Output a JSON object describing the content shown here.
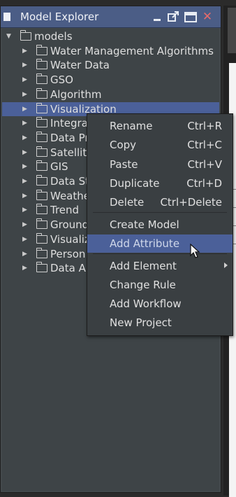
{
  "panel": {
    "title": "Model Explorer",
    "close_glyph": "✕",
    "icons": [
      "window-icon",
      "minimize-icon",
      "restore-icon",
      "maximize-icon",
      "close-icon"
    ]
  },
  "tree": {
    "root": {
      "label": "models",
      "expanded": true
    },
    "children": [
      "Water Management Algorithms",
      "Water Data",
      "GSO",
      "Algorithm",
      "Visualization",
      "Integrat",
      "Data Pr",
      "Satellite",
      "GIS",
      "Data St",
      "Weathe",
      "Trend",
      "Ground",
      "Visualiz",
      "Person",
      "Data Ar"
    ],
    "selected_index": 4
  },
  "context_menu": {
    "items": [
      {
        "label": "Rename",
        "shortcut": "Ctrl+R"
      },
      {
        "label": "Copy",
        "shortcut": "Ctrl+C"
      },
      {
        "label": "Paste",
        "shortcut": "Ctrl+V"
      },
      {
        "label": "Duplicate",
        "shortcut": "Ctrl+D"
      },
      {
        "label": "Delete",
        "shortcut": "Ctrl+Delete"
      },
      {
        "label": "Create Model",
        "shortcut": ""
      },
      {
        "label": "Add Attribute",
        "shortcut": "",
        "highlighted": true
      },
      {
        "label": "Add Element",
        "shortcut": "",
        "submenu": true
      },
      {
        "label": "Change Rule",
        "shortcut": ""
      },
      {
        "label": "Add Workflow",
        "shortcut": ""
      },
      {
        "label": "New Project",
        "shortcut": ""
      }
    ]
  },
  "colors": {
    "titlebar": "#4b5d86",
    "selection": "#4b6099",
    "panel_bg": "#3e4447",
    "menu_bg": "#3a3f42",
    "close_icon": "#e86b6b"
  }
}
